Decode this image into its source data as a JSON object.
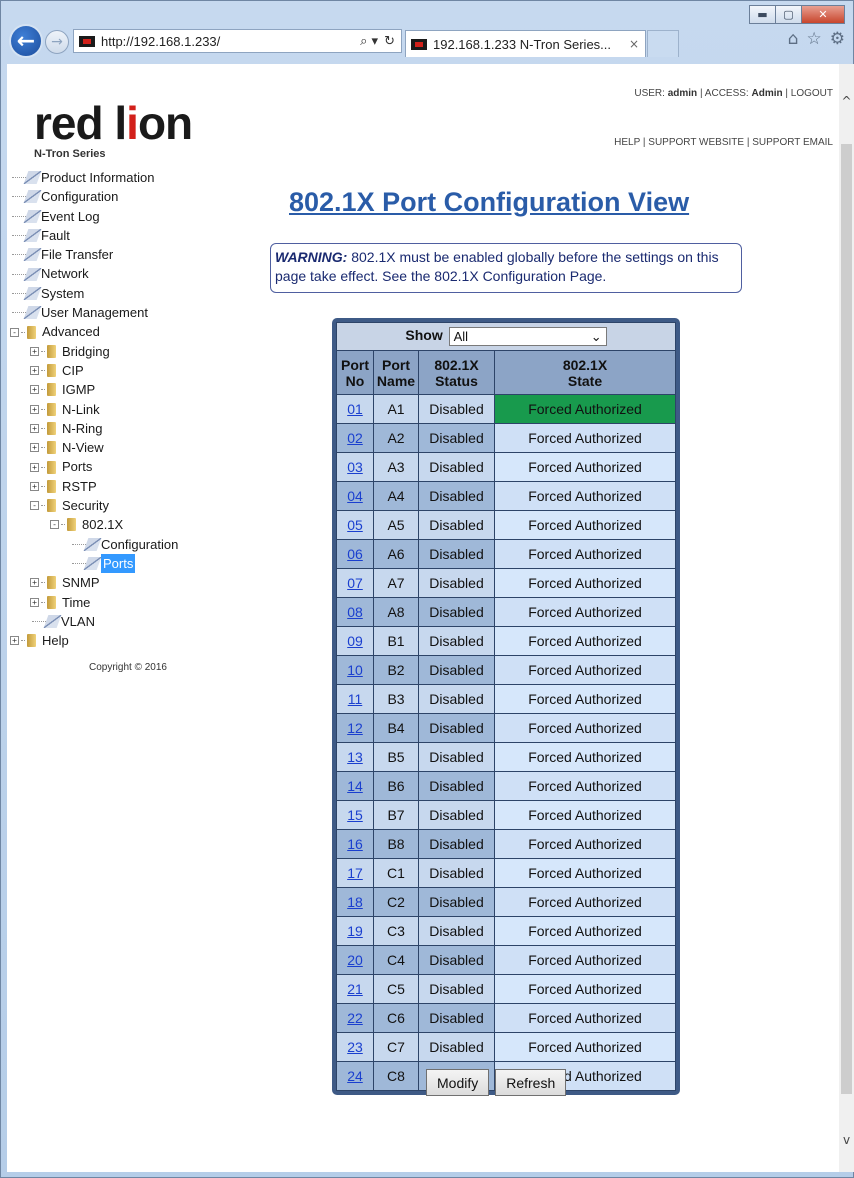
{
  "browser": {
    "url": "http://192.168.1.233/",
    "tab_title": "192.168.1.233 N-Tron Series...",
    "tab_close": "×",
    "search_glyph": "⌕ ▾",
    "refresh_glyph": "↻",
    "home_glyph": "⌂",
    "star_glyph": "☆",
    "gear_glyph": "⚙",
    "minimize_glyph": "▬",
    "maximize_glyph": "▢",
    "close_glyph": "✕",
    "scroll_up_glyph": "^",
    "scroll_down_glyph": "v",
    "back_glyph": "←",
    "forward_glyph": "→"
  },
  "header": {
    "logo_part1": "red l",
    "logo_part2": "i",
    "logo_part3": "on",
    "logo_sub": "N-Tron Series",
    "user_label": "USER:",
    "user": "admin",
    "access_label": "ACCESS:",
    "access": "Admin",
    "logout": "LOGOUT",
    "help": "HELP",
    "support_website": "SUPPORT WEBSITE",
    "support_email": "SUPPORT EMAIL",
    "sep": "|"
  },
  "tree": [
    {
      "label": "Product Information",
      "level": 0,
      "type": "page"
    },
    {
      "label": "Configuration",
      "level": 0,
      "type": "page"
    },
    {
      "label": "Event Log",
      "level": 0,
      "type": "page"
    },
    {
      "label": "Fault",
      "level": 0,
      "type": "page"
    },
    {
      "label": "File Transfer",
      "level": 0,
      "type": "page"
    },
    {
      "label": "Network",
      "level": 0,
      "type": "page"
    },
    {
      "label": "System",
      "level": 0,
      "type": "page"
    },
    {
      "label": "User Management",
      "level": 0,
      "type": "page"
    },
    {
      "label": "Advanced",
      "level": 0,
      "type": "folder",
      "toggle": "-"
    },
    {
      "label": "Bridging",
      "level": 1,
      "type": "folder",
      "toggle": "+"
    },
    {
      "label": "CIP",
      "level": 1,
      "type": "folder",
      "toggle": "+"
    },
    {
      "label": "IGMP",
      "level": 1,
      "type": "folder",
      "toggle": "+"
    },
    {
      "label": "N-Link",
      "level": 1,
      "type": "folder",
      "toggle": "+"
    },
    {
      "label": "N-Ring",
      "level": 1,
      "type": "folder",
      "toggle": "+"
    },
    {
      "label": "N-View",
      "level": 1,
      "type": "folder",
      "toggle": "+"
    },
    {
      "label": "Ports",
      "level": 1,
      "type": "folder",
      "toggle": "+"
    },
    {
      "label": "RSTP",
      "level": 1,
      "type": "folder",
      "toggle": "+"
    },
    {
      "label": "Security",
      "level": 1,
      "type": "folder",
      "toggle": "-"
    },
    {
      "label": "802.1X",
      "level": 2,
      "type": "folder",
      "toggle": "-"
    },
    {
      "label": "Configuration",
      "level": 3,
      "type": "page"
    },
    {
      "label": "Ports",
      "level": 3,
      "type": "page",
      "selected": true
    },
    {
      "label": "SNMP",
      "level": 1,
      "type": "folder",
      "toggle": "+"
    },
    {
      "label": "Time",
      "level": 1,
      "type": "folder",
      "toggle": "+"
    },
    {
      "label": "VLAN",
      "level": 1,
      "type": "page"
    },
    {
      "label": "Help",
      "level": 0,
      "type": "folder",
      "toggle": "+"
    }
  ],
  "copyright": "Copyright © 2016",
  "main": {
    "title": "802.1X Port Configuration View",
    "warning_title": "WARNING:",
    "warning_text": " 802.1X must be enabled globally before the settings on this page take effect. See the 802.1X Configuration Page.",
    "show_label": "Show",
    "show_value": "All",
    "show_caret": "⌄",
    "columns": [
      {
        "line1": "Port",
        "line2": "No"
      },
      {
        "line1": "Port",
        "line2": "Name"
      },
      {
        "line1": "802.1X",
        "line2": "Status"
      },
      {
        "line1": "802.1X",
        "line2": "State"
      }
    ],
    "rows": [
      {
        "no": "01",
        "name": "A1",
        "status": "Disabled",
        "state": "Forced Authorized",
        "active": true
      },
      {
        "no": "02",
        "name": "A2",
        "status": "Disabled",
        "state": "Forced Authorized"
      },
      {
        "no": "03",
        "name": "A3",
        "status": "Disabled",
        "state": "Forced Authorized"
      },
      {
        "no": "04",
        "name": "A4",
        "status": "Disabled",
        "state": "Forced Authorized"
      },
      {
        "no": "05",
        "name": "A5",
        "status": "Disabled",
        "state": "Forced Authorized"
      },
      {
        "no": "06",
        "name": "A6",
        "status": "Disabled",
        "state": "Forced Authorized"
      },
      {
        "no": "07",
        "name": "A7",
        "status": "Disabled",
        "state": "Forced Authorized"
      },
      {
        "no": "08",
        "name": "A8",
        "status": "Disabled",
        "state": "Forced Authorized"
      },
      {
        "no": "09",
        "name": "B1",
        "status": "Disabled",
        "state": "Forced Authorized"
      },
      {
        "no": "10",
        "name": "B2",
        "status": "Disabled",
        "state": "Forced Authorized"
      },
      {
        "no": "11",
        "name": "B3",
        "status": "Disabled",
        "state": "Forced Authorized"
      },
      {
        "no": "12",
        "name": "B4",
        "status": "Disabled",
        "state": "Forced Authorized"
      },
      {
        "no": "13",
        "name": "B5",
        "status": "Disabled",
        "state": "Forced Authorized"
      },
      {
        "no": "14",
        "name": "B6",
        "status": "Disabled",
        "state": "Forced Authorized"
      },
      {
        "no": "15",
        "name": "B7",
        "status": "Disabled",
        "state": "Forced Authorized"
      },
      {
        "no": "16",
        "name": "B8",
        "status": "Disabled",
        "state": "Forced Authorized"
      },
      {
        "no": "17",
        "name": "C1",
        "status": "Disabled",
        "state": "Forced Authorized"
      },
      {
        "no": "18",
        "name": "C2",
        "status": "Disabled",
        "state": "Forced Authorized"
      },
      {
        "no": "19",
        "name": "C3",
        "status": "Disabled",
        "state": "Forced Authorized"
      },
      {
        "no": "20",
        "name": "C4",
        "status": "Disabled",
        "state": "Forced Authorized"
      },
      {
        "no": "21",
        "name": "C5",
        "status": "Disabled",
        "state": "Forced Authorized"
      },
      {
        "no": "22",
        "name": "C6",
        "status": "Disabled",
        "state": "Forced Authorized"
      },
      {
        "no": "23",
        "name": "C7",
        "status": "Disabled",
        "state": "Forced Authorized"
      },
      {
        "no": "24",
        "name": "C8",
        "status": "Disabled",
        "state": "Forced Authorized"
      }
    ],
    "modify_label": "Modify",
    "refresh_label": "Refresh"
  },
  "colors": {
    "title_blue": "#2a5ca8",
    "brand_red": "#d2201a",
    "active_state_green": "#189a4d",
    "grid_border": "#3e5a86"
  }
}
